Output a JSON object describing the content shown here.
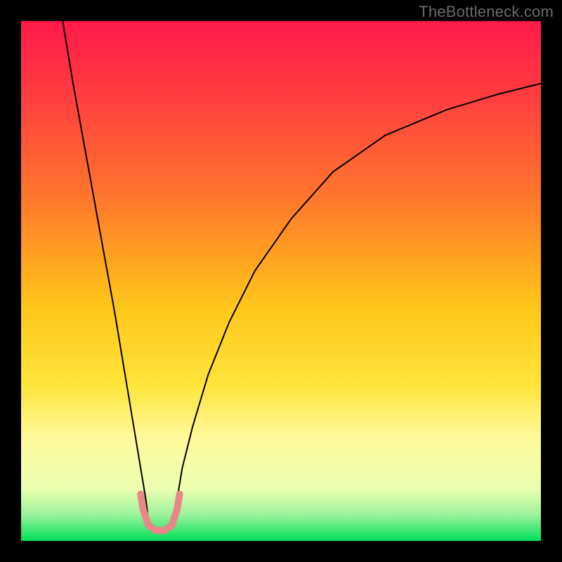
{
  "watermark": "TheBottleneck.com",
  "chart_data": {
    "type": "line",
    "title": "",
    "xlabel": "",
    "ylabel": "",
    "xlim": [
      0,
      100
    ],
    "ylim": [
      0,
      100
    ],
    "grid": false,
    "background_gradient": {
      "stops": [
        {
          "offset": 0.0,
          "color": "#ff1a4b"
        },
        {
          "offset": 0.15,
          "color": "#ff3f3f"
        },
        {
          "offset": 0.35,
          "color": "#ff7a2a"
        },
        {
          "offset": 0.55,
          "color": "#ffc61a"
        },
        {
          "offset": 0.7,
          "color": "#ffe43a"
        },
        {
          "offset": 0.8,
          "color": "#fff99a"
        },
        {
          "offset": 0.9,
          "color": "#eaffb0"
        },
        {
          "offset": 0.95,
          "color": "#9cf29c"
        },
        {
          "offset": 1.0,
          "color": "#00e05a"
        }
      ]
    },
    "series": [
      {
        "name": "curve-left",
        "type": "line",
        "color": "#000000",
        "x": [
          8,
          10,
          12,
          14,
          16,
          18,
          19,
          20,
          21,
          22,
          23,
          24,
          24.5
        ],
        "y": [
          100,
          88,
          77,
          66,
          55,
          44,
          38,
          32,
          26,
          20,
          14,
          8,
          4
        ]
      },
      {
        "name": "curve-right",
        "type": "line",
        "color": "#000000",
        "x": [
          29.5,
          30,
          31,
          33,
          36,
          40,
          45,
          52,
          60,
          70,
          82,
          92,
          100
        ],
        "y": [
          4,
          8,
          14,
          22,
          32,
          42,
          52,
          62,
          71,
          78,
          83,
          86,
          88
        ]
      },
      {
        "name": "trough-highlight",
        "type": "line",
        "color": "#e98788",
        "stroke_width": 10,
        "x": [
          23.0,
          23.5,
          24.5,
          26.0,
          27.5,
          29.0,
          30.0,
          30.5
        ],
        "y": [
          9.0,
          6.0,
          3.0,
          2.0,
          2.0,
          3.0,
          6.0,
          9.0
        ]
      }
    ],
    "trough": {
      "x_center": 27,
      "y_min": 2
    }
  }
}
